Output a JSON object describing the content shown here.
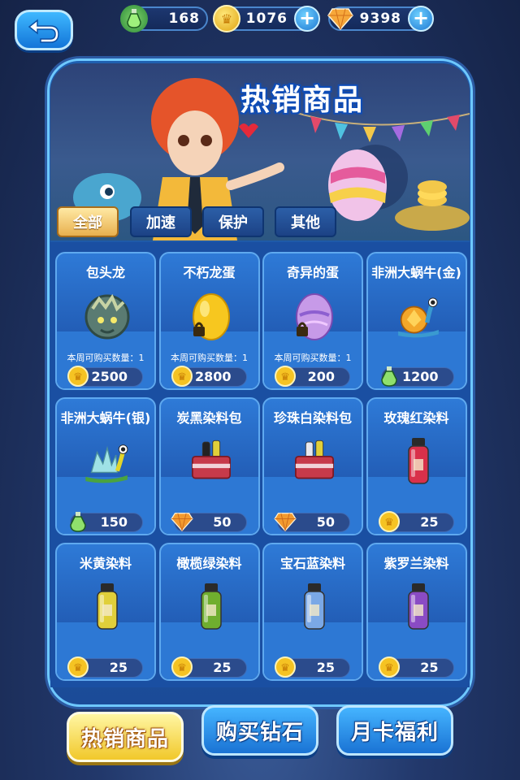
{
  "top_bar": {
    "potion_count": "168",
    "coin_count": "1076",
    "gem_count": "9398"
  },
  "banner": {
    "title": "热销商品"
  },
  "filter_tabs": [
    "全部",
    "加速",
    "保护",
    "其他"
  ],
  "items": [
    {
      "name": "包头龙",
      "limit": "本周可购买数量：1",
      "price": "2500",
      "currency": "coin",
      "art": "dragon-head-icon"
    },
    {
      "name": "不朽龙蛋",
      "limit": "本周可购买数量：1",
      "price": "2800",
      "currency": "coin",
      "art": "golden-egg-icon"
    },
    {
      "name": "奇异的蛋",
      "limit": "本周可购买数量：1",
      "price": "200",
      "currency": "coin",
      "art": "purple-egg-icon"
    },
    {
      "name": "非洲大蜗牛(金)",
      "limit": "",
      "price": "1200",
      "currency": "potion",
      "art": "gold-snail-icon"
    },
    {
      "name": "非洲大蜗牛(银)",
      "limit": "",
      "price": "150",
      "currency": "potion",
      "art": "silver-snail-icon"
    },
    {
      "name": "炭黑染料包",
      "limit": "",
      "price": "50",
      "currency": "gem",
      "art": "dye-pack-icon"
    },
    {
      "name": "珍珠白染料包",
      "limit": "",
      "price": "50",
      "currency": "gem",
      "art": "dye-pack-icon"
    },
    {
      "name": "玫瑰红染料",
      "limit": "",
      "price": "25",
      "currency": "coin",
      "art": "dye-bottle-icon"
    },
    {
      "name": "米黄染料",
      "limit": "",
      "price": "25",
      "currency": "coin",
      "art": "dye-bottle-icon"
    },
    {
      "name": "橄榄绿染料",
      "limit": "",
      "price": "25",
      "currency": "coin",
      "art": "dye-bottle-icon"
    },
    {
      "name": "宝石蓝染料",
      "limit": "",
      "price": "25",
      "currency": "coin",
      "art": "dye-bottle-icon"
    },
    {
      "name": "紫罗兰染料",
      "limit": "",
      "price": "25",
      "currency": "coin",
      "art": "dye-bottle-icon"
    }
  ],
  "dye_colors": [
    "#d9304a",
    "#e0cf3a",
    "#6fae2e",
    "#7aa8e6",
    "#8a4bc4"
  ],
  "bottom_tabs": [
    "热销商品",
    "购买钻石",
    "月卡福利"
  ],
  "colors": {
    "accent": "#f1c82a",
    "panel": "#1f5fb0",
    "coin": "#f5c323",
    "gem": "#f29a2e"
  }
}
